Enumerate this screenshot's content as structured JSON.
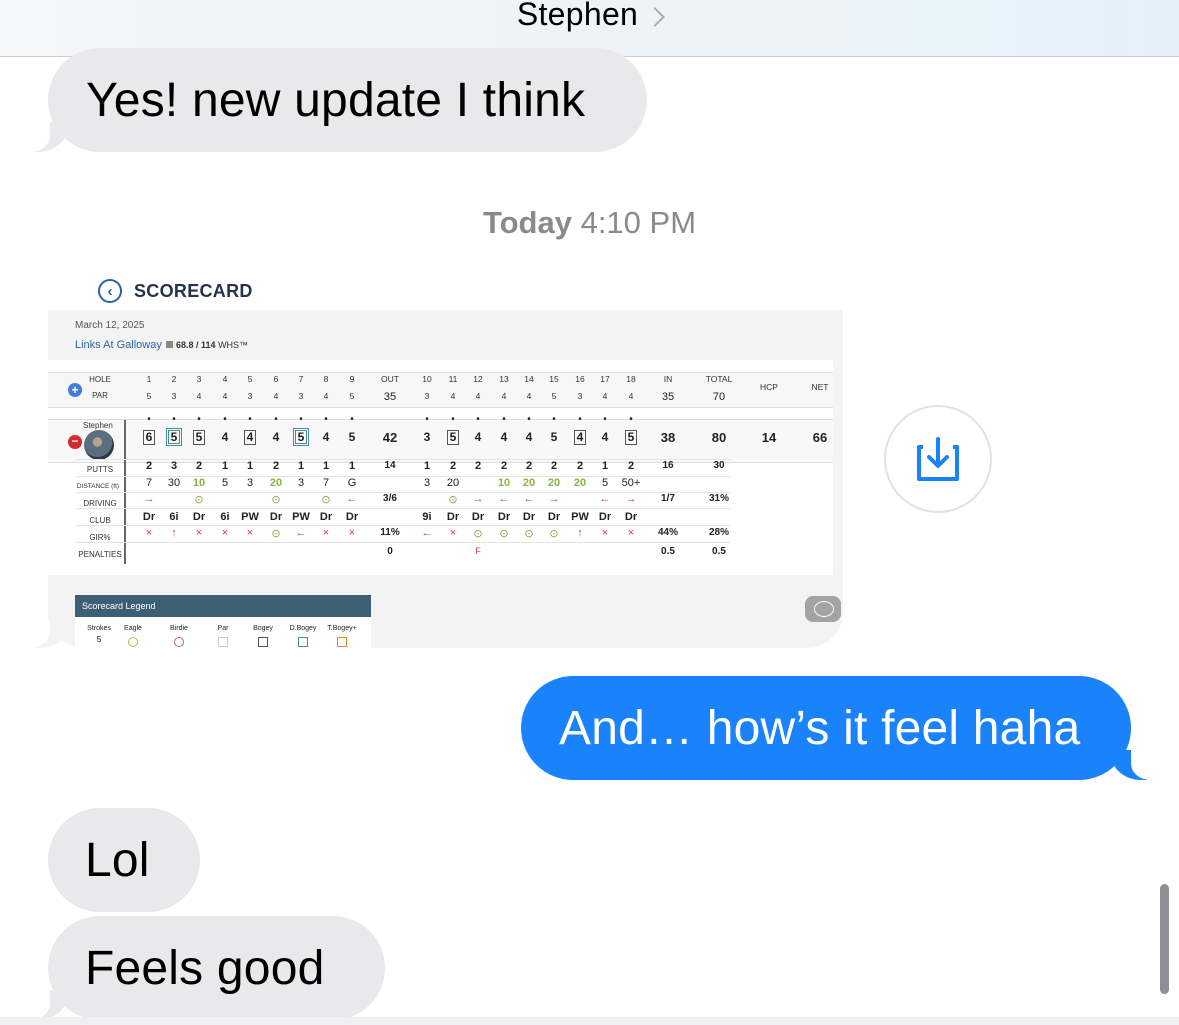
{
  "header": {
    "contact_name": "Stephen"
  },
  "messages": {
    "m1": "Yes! new update I think",
    "m2": "And… how’s it feel haha",
    "m3": "Lol",
    "m4": "Feels good"
  },
  "timestamp": {
    "day": "Today",
    "time": "4:10 PM"
  },
  "scorecard": {
    "title": "SCORECARD",
    "date": "March 12, 2025",
    "course": "Links At Galloway",
    "rating": "68.8 / 114",
    "rating_suffix": "WHS™",
    "labels": {
      "hole": "HOLE",
      "par": "PAR",
      "putts": "PUTTS",
      "distance": "DISTANCE (ft)",
      "driving": "DRIVING",
      "club": "CLUB",
      "gir": "GIR%",
      "penalties": "PENALTIES",
      "out": "OUT",
      "in": "IN",
      "total": "TOTAL",
      "hcp": "HCP",
      "net": "NET"
    },
    "player": "Stephen",
    "holes": [
      "1",
      "2",
      "3",
      "4",
      "5",
      "6",
      "7",
      "8",
      "9",
      "10",
      "11",
      "12",
      "13",
      "14",
      "15",
      "16",
      "17",
      "18"
    ],
    "par": [
      "5",
      "3",
      "4",
      "4",
      "3",
      "4",
      "3",
      "4",
      "5",
      "3",
      "4",
      "4",
      "4",
      "4",
      "5",
      "3",
      "4",
      "4"
    ],
    "par_out": "35",
    "par_in": "35",
    "par_total": "70",
    "scores": [
      "6",
      "5",
      "5",
      "4",
      "4",
      "4",
      "5",
      "4",
      "5",
      "3",
      "5",
      "4",
      "4",
      "4",
      "5",
      "4",
      "4",
      "5"
    ],
    "score_out": "42",
    "score_in": "38",
    "score_total": "80",
    "hcp": "14",
    "net": "66",
    "putts": [
      "2",
      "3",
      "2",
      "1",
      "1",
      "2",
      "1",
      "1",
      "1",
      "1",
      "2",
      "2",
      "2",
      "2",
      "2",
      "2",
      "1",
      "2"
    ],
    "putts_out": "14",
    "putts_in": "16",
    "putts_total": "30",
    "distance": [
      "7",
      "30",
      "10",
      "5",
      "3",
      "20",
      "3",
      "7",
      "G",
      "3",
      "20",
      "",
      "10",
      "20",
      "20",
      "20",
      "5",
      "50+"
    ],
    "driving": [
      "→",
      "",
      "⊙",
      "",
      "",
      "⊙",
      "",
      "⊙",
      "←",
      "",
      "⊙",
      "→",
      "←",
      "←",
      "→",
      "",
      "←",
      "→"
    ],
    "driving_out": "3/6",
    "driving_in": "1/7",
    "driving_total": "31%",
    "club": [
      "Dr",
      "6i",
      "Dr",
      "6i",
      "PW",
      "Dr",
      "PW",
      "Dr",
      "Dr",
      "9i",
      "Dr",
      "Dr",
      "Dr",
      "Dr",
      "Dr",
      "PW",
      "Dr",
      "Dr"
    ],
    "gir": [
      "×",
      "↑",
      "×",
      "×",
      "×",
      "⊙",
      "←",
      "×",
      "×",
      "←",
      "×",
      "⊙",
      "⊙",
      "⊙",
      "⊙",
      "↑",
      "×",
      "×"
    ],
    "gir_out": "11%",
    "gir_in": "44%",
    "gir_total": "28%",
    "penalties": [
      "",
      "",
      "",
      "",
      "",
      "",
      "",
      "",
      "",
      "",
      "",
      "F",
      "",
      "",
      "",
      "",
      "",
      ""
    ],
    "pen_out": "0",
    "pen_in": "0.5",
    "pen_total": "0.5",
    "legend": {
      "title": "Scorecard Legend",
      "items": [
        "Strokes",
        "Eagle",
        "Birdie",
        "Par",
        "Bogey",
        "D.Bogey",
        "T.Bogey+"
      ],
      "strokes_sample": "5"
    }
  },
  "colors": {
    "outgoing": "#1a82fb",
    "incoming": "#e9e9eb",
    "legend_head": "#3d5f75"
  },
  "icons": {
    "save": "download-icon",
    "back": "chevron-left-icon",
    "comment": "speech-bubble-icon"
  }
}
